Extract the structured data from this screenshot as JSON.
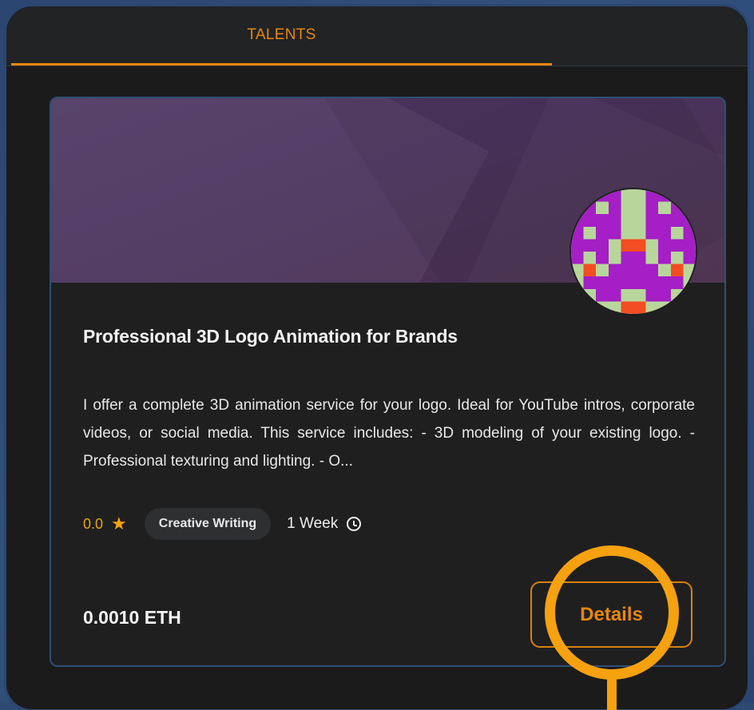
{
  "tabs": [
    {
      "label": "TALENTS",
      "active": true
    }
  ],
  "card": {
    "title": "Professional 3D Logo Animation for Brands",
    "description": "I offer a complete 3D animation service for your logo. Ideal for YouTube intros, corporate videos, or social media. This service includes: - 3D modeling of your existing logo. - Professional texturing and lighting. - O...",
    "rating": "0.0",
    "category": "Creative Writing",
    "duration": "1 Week",
    "price": "0.0010 ETH",
    "details_label": "Details"
  },
  "icons": {
    "rating": "star-icon",
    "duration": "clock-icon",
    "avatar": "pixel-identicon"
  },
  "colors": {
    "accent": "#e7860f",
    "highlight": "#f6a10f",
    "card_bg": "#1f1f20",
    "card_border": "#2f4f74",
    "banner": "#4a345e",
    "avatar_green": "#b8d69c",
    "avatar_purple": "#a51ec6",
    "avatar_red": "#f34d23"
  }
}
